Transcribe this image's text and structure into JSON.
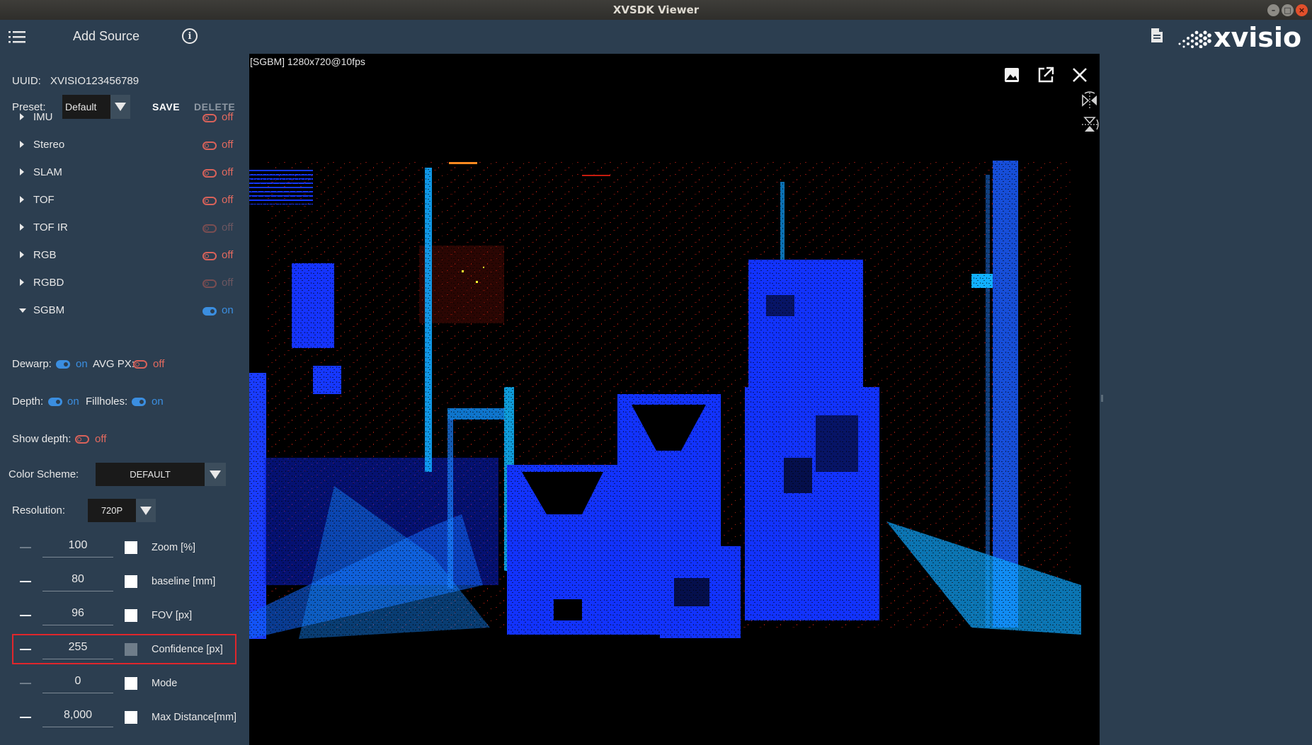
{
  "window": {
    "title": "XVSDK Viewer"
  },
  "header": {
    "add_source": "Add Source",
    "info_glyph": "i",
    "brand_text": "xvisio"
  },
  "device": {
    "uuid_label": "UUID:",
    "uuid_value": "XVISIO123456789",
    "preset_label": "Preset:",
    "preset_value": "Default",
    "save_label": "SAVE",
    "delete_label": "DELETE"
  },
  "modules": [
    {
      "label": "IMU",
      "state": "off",
      "enabled": true,
      "expanded": false
    },
    {
      "label": "Stereo",
      "state": "off",
      "enabled": true,
      "expanded": false
    },
    {
      "label": "SLAM",
      "state": "off",
      "enabled": true,
      "expanded": false
    },
    {
      "label": "TOF",
      "state": "off",
      "enabled": true,
      "expanded": false
    },
    {
      "label": "TOF IR",
      "state": "off",
      "enabled": false,
      "expanded": false
    },
    {
      "label": "RGB",
      "state": "off",
      "enabled": true,
      "expanded": false
    },
    {
      "label": "RGBD",
      "state": "off",
      "enabled": false,
      "expanded": false
    },
    {
      "label": "SGBM",
      "state": "on",
      "enabled": true,
      "expanded": true
    }
  ],
  "sgbm": {
    "dewarp_label": "Dewarp:",
    "dewarp_state": "on",
    "avgpx_label": "AVG PX:",
    "avgpx_state": "off",
    "depth_label": "Depth:",
    "depth_state": "on",
    "fillholes_label": "Fillholes:",
    "fillholes_state": "on",
    "showdepth_label": "Show depth:",
    "showdepth_state": "off",
    "colorscheme_label": "Color Scheme:",
    "colorscheme_value": "DEFAULT",
    "resolution_label": "Resolution:",
    "resolution_value": "720P",
    "params": [
      {
        "value": "100",
        "label": "Zoom [%]",
        "minus_enabled": false,
        "plus_enabled": true
      },
      {
        "value": "80",
        "label": "baseline [mm]",
        "minus_enabled": true,
        "plus_enabled": true
      },
      {
        "value": "96",
        "label": "FOV [px]",
        "minus_enabled": true,
        "plus_enabled": true
      },
      {
        "value": "255",
        "label": "Confidence [px]",
        "minus_enabled": true,
        "plus_enabled": false
      },
      {
        "value": "0",
        "label": "Mode",
        "minus_enabled": false,
        "plus_enabled": true
      },
      {
        "value": "8,000",
        "label": "Max Distance[mm]",
        "minus_enabled": true,
        "plus_enabled": true
      }
    ]
  },
  "viewer": {
    "stream_label": "[SGBM]  1280x720@10fps"
  },
  "colors": {
    "panel": "#2c3e50",
    "toggle_on": "#3b8ee0",
    "toggle_off": "#d9625a",
    "highlight": "#e0262b",
    "depth_blue": "#1432ff",
    "depth_cyan": "#13b4ff",
    "depth_red": "#ff2010"
  },
  "icons": {
    "menu": "list-menu-icon",
    "info": "info-circle-icon",
    "doc": "document-icon",
    "snapshot": "image-icon",
    "popout": "external-link-icon",
    "close": "close-icon",
    "flip_h": "flip-horizontal-icon",
    "flip_v": "flip-vertical-icon"
  }
}
